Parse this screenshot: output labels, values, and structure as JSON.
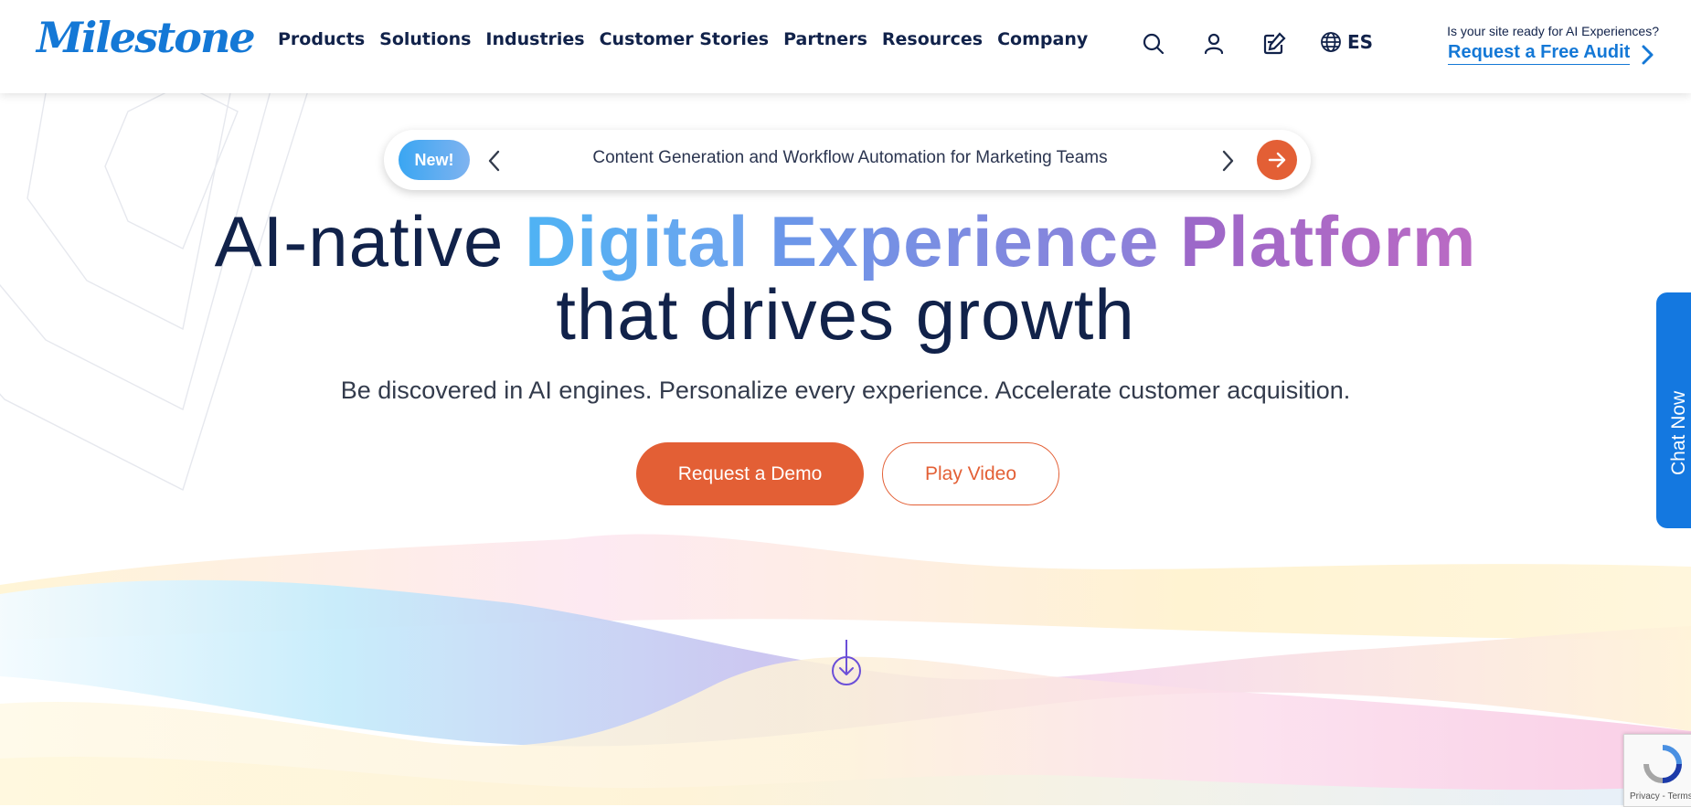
{
  "brand": {
    "logo_text": "Milestone"
  },
  "nav": {
    "items": [
      "Products",
      "Solutions",
      "Industries",
      "Customer Stories",
      "Partners",
      "Resources",
      "Company"
    ]
  },
  "header": {
    "icons": [
      "search-icon",
      "user-icon",
      "edit-icon",
      "globe-icon"
    ],
    "language": "ES",
    "audit_question": "Is your site ready for AI Experiences?",
    "audit_link": "Request a Free Audit"
  },
  "announcement": {
    "badge": "New!",
    "text": "Content Generation and Workflow Automation for Marketing Teams"
  },
  "hero": {
    "title_prefix": "AI-native ",
    "title_word1": "Digital",
    "title_word2": "Experience",
    "title_word3": "Platform",
    "title_line2": "that drives growth",
    "subtitle": "Be discovered in AI engines. Personalize every experience. Accelerate customer acquisition.",
    "primary_cta": "Request a Demo",
    "secondary_cta": "Play Video"
  },
  "chat": {
    "label": "Chat Now"
  },
  "recaptcha": {
    "text": "Privacy - Terms"
  },
  "colors": {
    "brand_blue": "#1478d6",
    "accent_orange": "#e35f35",
    "navy": "#11224a"
  }
}
